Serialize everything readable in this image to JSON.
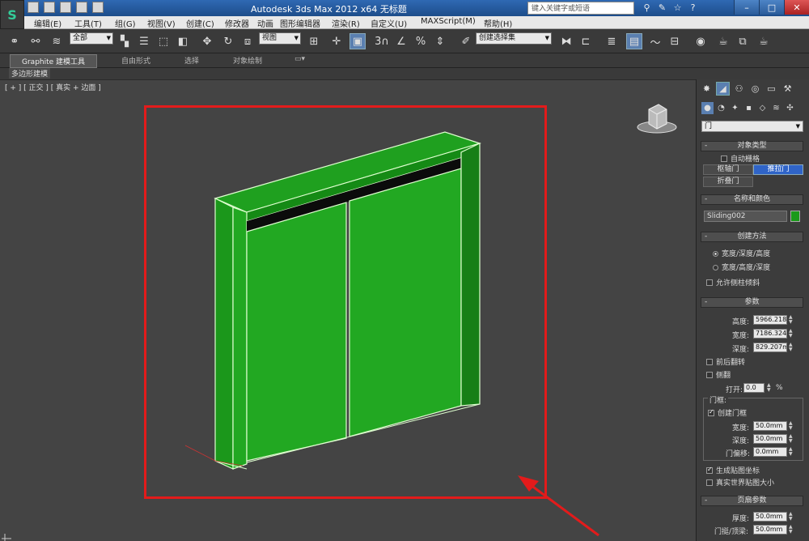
{
  "titlebar": {
    "title": "Autodesk 3ds Max  2012 x64     无标题",
    "search_placeholder": "键入关键字或短语"
  },
  "menu": [
    "编辑(E)",
    "工具(T)",
    "组(G)",
    "视图(V)",
    "创建(C)",
    "修改器",
    "动画",
    "图形编辑器",
    "渲染(R)",
    "自定义(U)",
    "MAXScript(M)",
    "帮助(H)"
  ],
  "toolbar": {
    "selection_filter": "全部",
    "ref_coord": "视图",
    "named_selection": "创建选择集",
    "snap_label": "3"
  },
  "ribbon": {
    "tabs": [
      "Graphite 建模工具",
      "自由形式",
      "选择",
      "对象绘制"
    ],
    "sub_label": "多边形建模"
  },
  "viewport": {
    "label": "[ + ] [ 正交 ] [ 真实 + 边面 ]"
  },
  "panel": {
    "category_dropdown": "门",
    "object_type": {
      "title": "对象类型",
      "autogrid": "自动栅格",
      "buttons": [
        "枢轴门",
        "推拉门",
        "折叠门"
      ]
    },
    "name_color": {
      "title": "名称和颜色",
      "name": "Sliding002",
      "color": "#1a9a1a"
    },
    "creation_method": {
      "title": "创建方法",
      "options": [
        "宽度/深度/高度",
        "宽度/高度/深度"
      ],
      "allow_side_tilt": "允许侧柱倾斜"
    },
    "params": {
      "title": "参数",
      "height_label": "高度:",
      "height": "5966.218",
      "width_label": "宽度:",
      "width": "7186.324",
      "depth_label": "深度:",
      "depth": "829.207m",
      "flip_front_back": "前后翻转",
      "flip_side": "侧翻",
      "open_label": "打开:",
      "open_value": "0.0",
      "open_unit": "%",
      "frame_group": "门框:",
      "create_frame": "创建门框",
      "frame_width_label": "宽度:",
      "frame_width": "50.0mm",
      "frame_depth_label": "深度:",
      "frame_depth": "50.0mm",
      "door_offset_label": "门偏移:",
      "door_offset": "0.0mm",
      "gen_mapping": "生成贴图坐标",
      "real_world": "真实世界贴图大小"
    },
    "leaf_params": {
      "title": "页扇参数",
      "thickness_label": "厚度:",
      "thickness": "50.0mm",
      "stiles_label": "门挺/顶梁:",
      "stiles": "50.0mm"
    }
  }
}
